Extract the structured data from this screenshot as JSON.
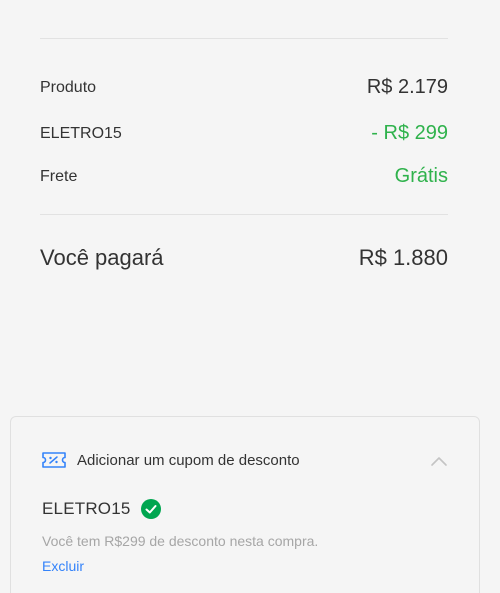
{
  "summary": {
    "product_label": "Produto",
    "product_value": "R$ 2.179",
    "coupon_label": "ELETRO15",
    "coupon_value": "- R$ 299",
    "shipping_label": "Frete",
    "shipping_value": "Grátis",
    "total_label": "Você pagará",
    "total_value": "R$ 1.880"
  },
  "coupon_panel": {
    "title": "Adicionar um cupom de desconto",
    "applied_code": "ELETRO15",
    "message": "Você tem R$299 de desconto nesta compra.",
    "remove_label": "Excluir",
    "icons": {
      "coupon": "coupon-ticket-icon",
      "collapse": "chevron-up-icon",
      "applied": "check-circle-icon"
    }
  },
  "colors": {
    "background": "#f5f5f5",
    "text": "#333333",
    "discount_green": "#2fb24c",
    "muted": "#a6a6a6",
    "link_blue": "#3483fa",
    "check_green": "#00a650"
  }
}
